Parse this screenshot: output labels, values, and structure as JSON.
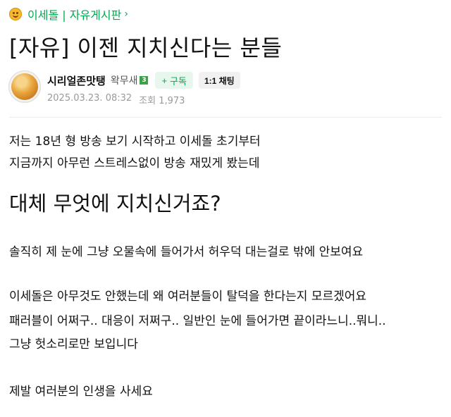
{
  "board": {
    "label": "이세돌 | 자유게시판",
    "chevron": "›"
  },
  "post": {
    "title": "[자유] 이젠 지치신다는 분들",
    "author": {
      "nickname": "시리얼존맛탱",
      "rank": "왁무새",
      "rank_level": "3",
      "subscribe_label": "구독",
      "subscribe_plus": "+",
      "chat_label": "1:1 채팅"
    },
    "date": "2025.03.23. 08:32",
    "views_label": "조회 1,973",
    "body": {
      "line1": "저는 18년 형 방송 보기 시작하고 이세돌 초기부터",
      "line2": "지금까지 아무런 스트레스없이 방송 재밌게 봤는데",
      "heading": "대체 무엇에 지치신거죠?",
      "line3": "솔직히 제 눈에 그냥 오물속에 들어가서 허우덕 대는걸로 밖에 안보여요",
      "line4": "이세돌은 아무것도 안했는데 왜 여러분들이 탈덕을 한다는지 모르겠어요",
      "line5": "패러블이 어쩌구.. 대응이 저쩌구.. 일반인 눈에 들어가면 끝이라느니..뭐니..",
      "line6": "그냥 헛소리로만 보입니다",
      "line7": "제발 여러분의 인생을 사세요"
    }
  },
  "colors": {
    "accent": "#03a94f",
    "meta": "#999999"
  }
}
